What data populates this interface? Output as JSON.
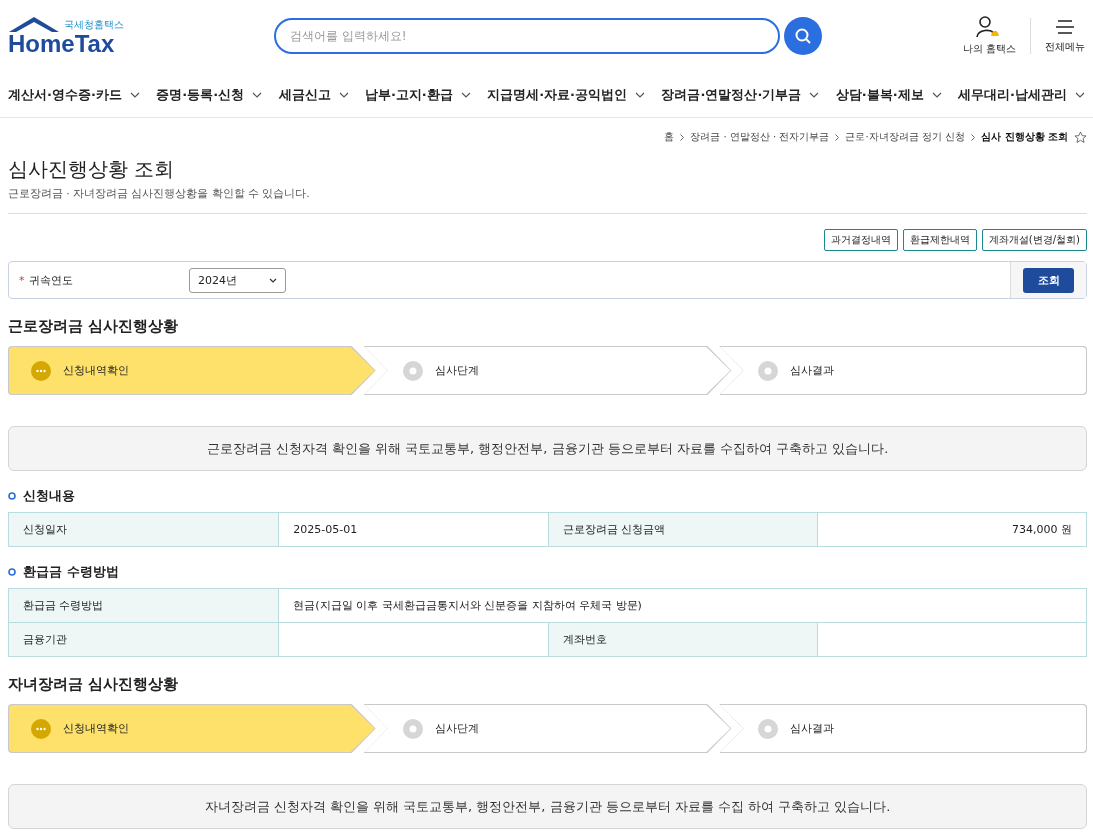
{
  "header": {
    "logo": {
      "caption": "국세청홈택스",
      "name": "HomeTax"
    },
    "search": {
      "placeholder": "검색어를 입력하세요!"
    },
    "user_links": [
      {
        "kind": "my",
        "label": "나의 홈택스"
      },
      {
        "kind": "menu",
        "label": "전체메뉴"
      }
    ]
  },
  "nav": [
    "계산서·영수증·카드",
    "증명·등록·신청",
    "세금신고",
    "납부·고지·환급",
    "지급명세·자료·공익법인",
    "장려금·연말정산·기부금",
    "상담·불복·제보",
    "세무대리·납세관리"
  ],
  "breadcrumb": [
    {
      "label": "홈",
      "current": false
    },
    {
      "label": "장려금 · 연말정산 · 전자기부금",
      "current": false
    },
    {
      "label": "근로·자녀장려금 정기 신청",
      "current": false
    },
    {
      "label": "심사 진행상황 조회",
      "current": true
    }
  ],
  "page": {
    "title": "심사진행상황 조회",
    "subtitle": "근로장려금 · 자녀장려금 심사진행상황을 확인할 수 있습니다."
  },
  "action_buttons": [
    "과거결정내역",
    "환급제한내역",
    "계좌개설(변경/철회)"
  ],
  "filter": {
    "label": "귀속연도",
    "required_mark": "*",
    "value": "2024년",
    "button": "조회"
  },
  "sections": [
    {
      "kind": "heading",
      "title": "근로장려금 심사진행상황"
    },
    {
      "kind": "steps",
      "steps": [
        {
          "label": "신청내역확인",
          "selected": true
        },
        {
          "label": "심사단계",
          "selected": false
        },
        {
          "label": "심사결과",
          "selected": false
        }
      ]
    },
    {
      "kind": "notice",
      "text": "근로장려금 신청자격 확인을 위해 국토교통부, 행정안전부, 금융기관 등으로부터 자료를 수집하여 구축하고 있습니다."
    },
    {
      "kind": "table",
      "title": "신청내용",
      "rows": [
        [
          {
            "kind": "label",
            "text": "신청일자"
          },
          {
            "kind": "value",
            "text": "2025-05-01"
          },
          {
            "kind": "label",
            "text": "근로장려금 신청금액"
          },
          {
            "kind": "amount",
            "text": "734,000 원"
          }
        ]
      ]
    },
    {
      "kind": "table",
      "title": "환급금 수령방법",
      "rows": [
        [
          {
            "kind": "label",
            "text": "환급금 수령방법"
          },
          {
            "kind": "wide",
            "text": "현금(지급일 이후 국세환급금통지서와 신분증을 지참하여 우체국 방문)"
          }
        ],
        [
          {
            "kind": "label",
            "text": "금융기관"
          },
          {
            "kind": "value"
          },
          {
            "kind": "label",
            "text": "계좌번호"
          },
          {
            "kind": "value"
          }
        ]
      ]
    },
    {
      "kind": "heading",
      "title": "자녀장려금 심사진행상황"
    },
    {
      "kind": "steps",
      "steps": [
        {
          "label": "신청내역확인",
          "selected": true
        },
        {
          "label": "심사단계",
          "selected": false
        },
        {
          "label": "심사결과",
          "selected": false
        }
      ]
    },
    {
      "kind": "notice",
      "text": "자녀장려금 신청자격 확인을 위해 국토교통부, 행정안전부, 금융기관 등으로부터 자료를 수집 하여 구축하고 있습니다."
    }
  ]
}
